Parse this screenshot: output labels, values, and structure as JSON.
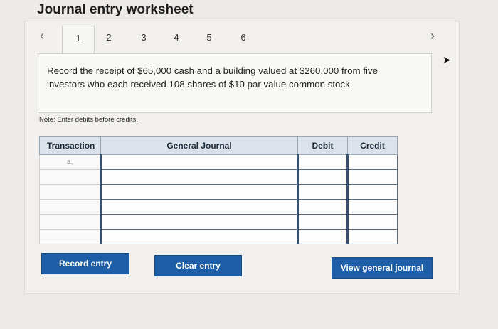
{
  "page": {
    "title": "Journal entry worksheet"
  },
  "pager": {
    "prev_icon": "‹",
    "next_icon": "›",
    "tabs": [
      "1",
      "2",
      "3",
      "4",
      "5",
      "6"
    ],
    "active_tab": "1"
  },
  "prompt": {
    "text": "Record the receipt of $65,000 cash and a building valued at $260,000 from five investors who each received 108 shares of $10 par value common stock."
  },
  "note": "Note: Enter debits before credits.",
  "journal": {
    "headers": {
      "transaction": "Transaction",
      "general_journal": "General Journal",
      "debit": "Debit",
      "credit": "Credit"
    },
    "rows": [
      {
        "transaction": "a.",
        "account": "",
        "debit": "",
        "credit": ""
      },
      {
        "transaction": "",
        "account": "",
        "debit": "",
        "credit": ""
      },
      {
        "transaction": "",
        "account": "",
        "debit": "",
        "credit": ""
      },
      {
        "transaction": "",
        "account": "",
        "debit": "",
        "credit": ""
      },
      {
        "transaction": "",
        "account": "",
        "debit": "",
        "credit": ""
      },
      {
        "transaction": "",
        "account": "",
        "debit": "",
        "credit": ""
      }
    ]
  },
  "buttons": {
    "record": "Record entry",
    "clear": "Clear entry",
    "view": "View general journal"
  },
  "colors": {
    "button": "#1e5ea6",
    "header_bg": "#dbe2ea"
  }
}
